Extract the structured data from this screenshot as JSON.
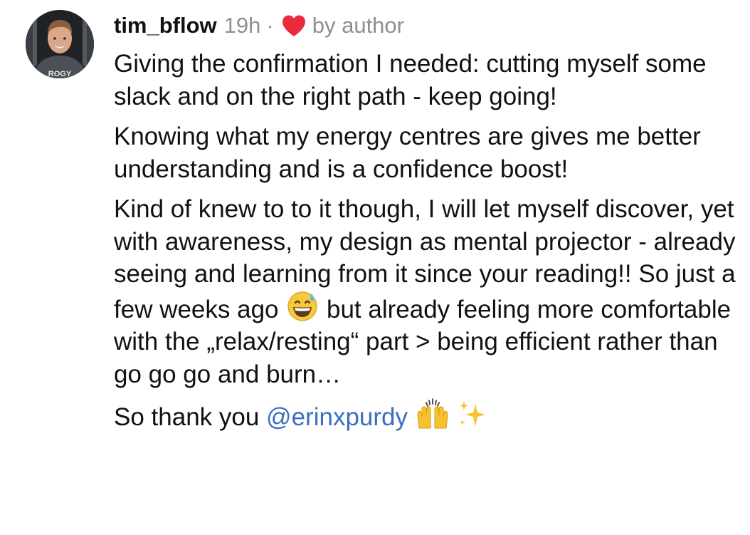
{
  "comment": {
    "username": "tim_bflow",
    "timestamp": "19h",
    "separator": "·",
    "liked_by": "by author",
    "paragraph1": "Giving the confirmation I needed: cutting myself some slack and on the right path - keep going!",
    "paragraph2": "Knowing what my energy centres are gives me better understanding and is a confidence boost!",
    "paragraph3_part1": "Kind of knew to to it though, I will let myself discover, yet with awareness, my design as mental projector - already seeing and learning from it since your reading!! So just a few weeks ago",
    "paragraph3_part2": "but already feeling more comfortable with the „relax/resting“ part > being efficient rather than go go go and burn…",
    "thanks_text": "So thank you",
    "mention": "@erinxpurdy",
    "avatar_text": "ROGY"
  },
  "icons": {
    "heart": "heart-icon",
    "emoji_sweat": "grinning-face-with-sweat-emoji",
    "emoji_hands": "raising-hands-emoji",
    "emoji_sparkles": "sparkles-emoji"
  },
  "colors": {
    "heart": "#ed2a3b",
    "mention": "#3c6fbf",
    "muted": "#8e8e93",
    "text": "#111111"
  }
}
